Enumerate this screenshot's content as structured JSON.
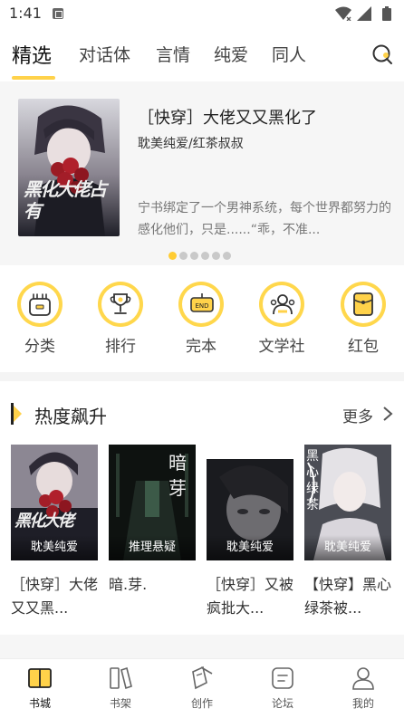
{
  "status": {
    "time": "1:41"
  },
  "tabs": [
    {
      "label": "精选"
    },
    {
      "label": "对话体"
    },
    {
      "label": "言情"
    },
    {
      "label": "纯爱"
    },
    {
      "label": "同人"
    }
  ],
  "banner": {
    "title": "［快穿］大佬又又黑化了",
    "tags": "耽美纯爱/红茶叔叔",
    "desc": "宁书绑定了一个男神系统，每个世界都努力的感化他们，只是......“乖，不准...",
    "cover_text": "黑化大佬占有",
    "dots_total": 6,
    "dots_active": 0
  },
  "quick_menu": [
    {
      "label": "分类",
      "icon": "bag-icon"
    },
    {
      "label": "排行",
      "icon": "trophy-icon"
    },
    {
      "label": "完本",
      "icon": "end-sign-icon"
    },
    {
      "label": "文学社",
      "icon": "group-icon"
    },
    {
      "label": "红包",
      "icon": "red-envelope-icon"
    }
  ],
  "hot": {
    "title": "热度飙升",
    "more": "更多",
    "books": [
      {
        "genre": "耽美纯爱",
        "title": "［快穿］大佬又又黑...",
        "cover_text": "黑化大佬"
      },
      {
        "genre": "推理悬疑",
        "title": "暗.芽.",
        "cover_text": "暗芽"
      },
      {
        "genre": "耽美纯爱",
        "title": "［快穿］又被疯批大...",
        "cover_text": ""
      },
      {
        "genre": "耽美纯爱",
        "title": "【快穿】黑心绿茶被...",
        "cover_text": "黑心绿茶"
      }
    ]
  },
  "nav": [
    {
      "label": "书城",
      "icon": "book-open-icon"
    },
    {
      "label": "书架",
      "icon": "bookshelf-icon"
    },
    {
      "label": "创作",
      "icon": "pen-icon"
    },
    {
      "label": "论坛",
      "icon": "forum-icon"
    },
    {
      "label": "我的",
      "icon": "user-icon"
    }
  ],
  "colors": {
    "accent": "#ffd24a",
    "dot_inactive": "#c9c9c9"
  }
}
